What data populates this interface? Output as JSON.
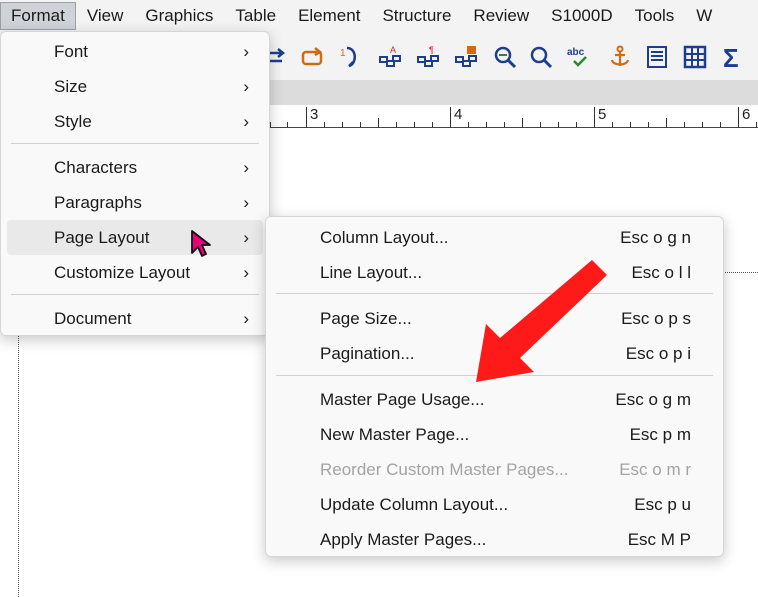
{
  "menubar": {
    "items": [
      "Format",
      "View",
      "Graphics",
      "Table",
      "Element",
      "Structure",
      "Review",
      "S1000D",
      "Tools",
      "W"
    ]
  },
  "toolbar": {
    "icons": [
      "repeat-arrow-icon",
      "rotate-arrow-icon",
      "clear-arrow-icon",
      "style-a-icon",
      "style-paragraph-icon",
      "style-table-icon",
      "zoom-search-icon",
      "find-icon",
      "spell-check-icon",
      "anchor-icon",
      "text-frame-icon",
      "table-grid-icon",
      "sigma-icon"
    ],
    "spell_check_text": "abc",
    "sigma_text": "Σ"
  },
  "ruler": {
    "numbers": [
      "3",
      "4",
      "5",
      "6"
    ]
  },
  "format_menu": {
    "items": [
      {
        "label": "Font",
        "arrow": "›"
      },
      {
        "label": "Size",
        "arrow": "›"
      },
      {
        "label": "Style",
        "arrow": "›"
      },
      {
        "label": "Characters",
        "arrow": "›"
      },
      {
        "label": "Paragraphs",
        "arrow": "›"
      },
      {
        "label": "Page Layout",
        "arrow": "›"
      },
      {
        "label": "Customize Layout",
        "arrow": "›"
      },
      {
        "label": "Document",
        "arrow": "›"
      }
    ]
  },
  "page_layout_submenu": {
    "items": [
      {
        "label": "Column Layout...",
        "shortcut": "Esc o g n"
      },
      {
        "label": "Line Layout...",
        "shortcut": "Esc o l l"
      },
      {
        "label": "Page Size...",
        "shortcut": "Esc o p s"
      },
      {
        "label": "Pagination...",
        "shortcut": "Esc o p i"
      },
      {
        "label": "Master Page Usage...",
        "shortcut": "Esc o g m"
      },
      {
        "label": "New Master Page...",
        "shortcut": "Esc p m"
      },
      {
        "label": "Reorder Custom Master Pages...",
        "shortcut": "Esc o m r"
      },
      {
        "label": "Update Column Layout...",
        "shortcut": "Esc p u"
      },
      {
        "label": "Apply Master Pages...",
        "shortcut": "Esc M P"
      }
    ]
  },
  "colors": {
    "highlight_arrow": "#ff1a1a",
    "cursor": "#e6007e",
    "icon_blue": "#1d3d8f",
    "icon_orange": "#d26a12"
  }
}
